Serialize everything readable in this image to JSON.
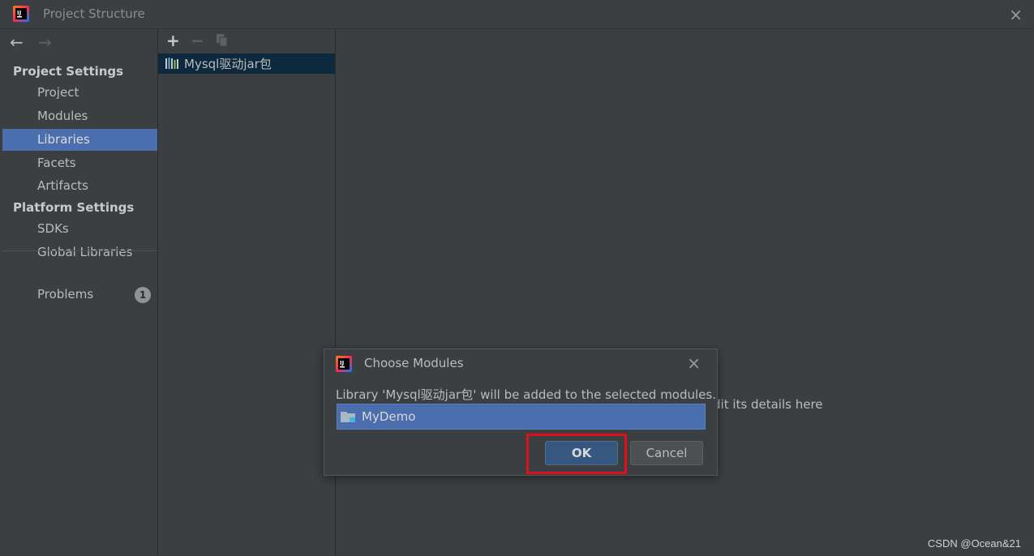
{
  "window": {
    "title": "Project Structure",
    "close_icon": "×"
  },
  "nav": {
    "back_icon": "←",
    "forward_icon": "→",
    "project_settings_header": "Project Settings",
    "project_items": [
      "Project",
      "Modules",
      "Libraries",
      "Facets",
      "Artifacts"
    ],
    "selected_item": "Libraries",
    "platform_settings_header": "Platform Settings",
    "platform_items": [
      "SDKs",
      "Global Libraries"
    ],
    "problems_label": "Problems",
    "problems_count": "1"
  },
  "libraries": {
    "toolbar": {
      "add": "+",
      "remove": "−"
    },
    "items": [
      {
        "label": "Mysql驱动jar包"
      }
    ]
  },
  "details": {
    "hint_visible": "dit its details here"
  },
  "dialog": {
    "title": "Choose Modules",
    "close_icon": "×",
    "message": "Library 'Mysql驱动jar包' will be added to the selected modules.",
    "modules": [
      {
        "label": "MyDemo",
        "selected": true
      }
    ],
    "ok_label": "OK",
    "cancel_label": "Cancel"
  },
  "watermark": "CSDN @Ocean&21",
  "colors": {
    "background": "#3c3f41",
    "selection": "#4b6eaf",
    "ok_button": "#365880",
    "highlight_box": "#e0101a"
  }
}
